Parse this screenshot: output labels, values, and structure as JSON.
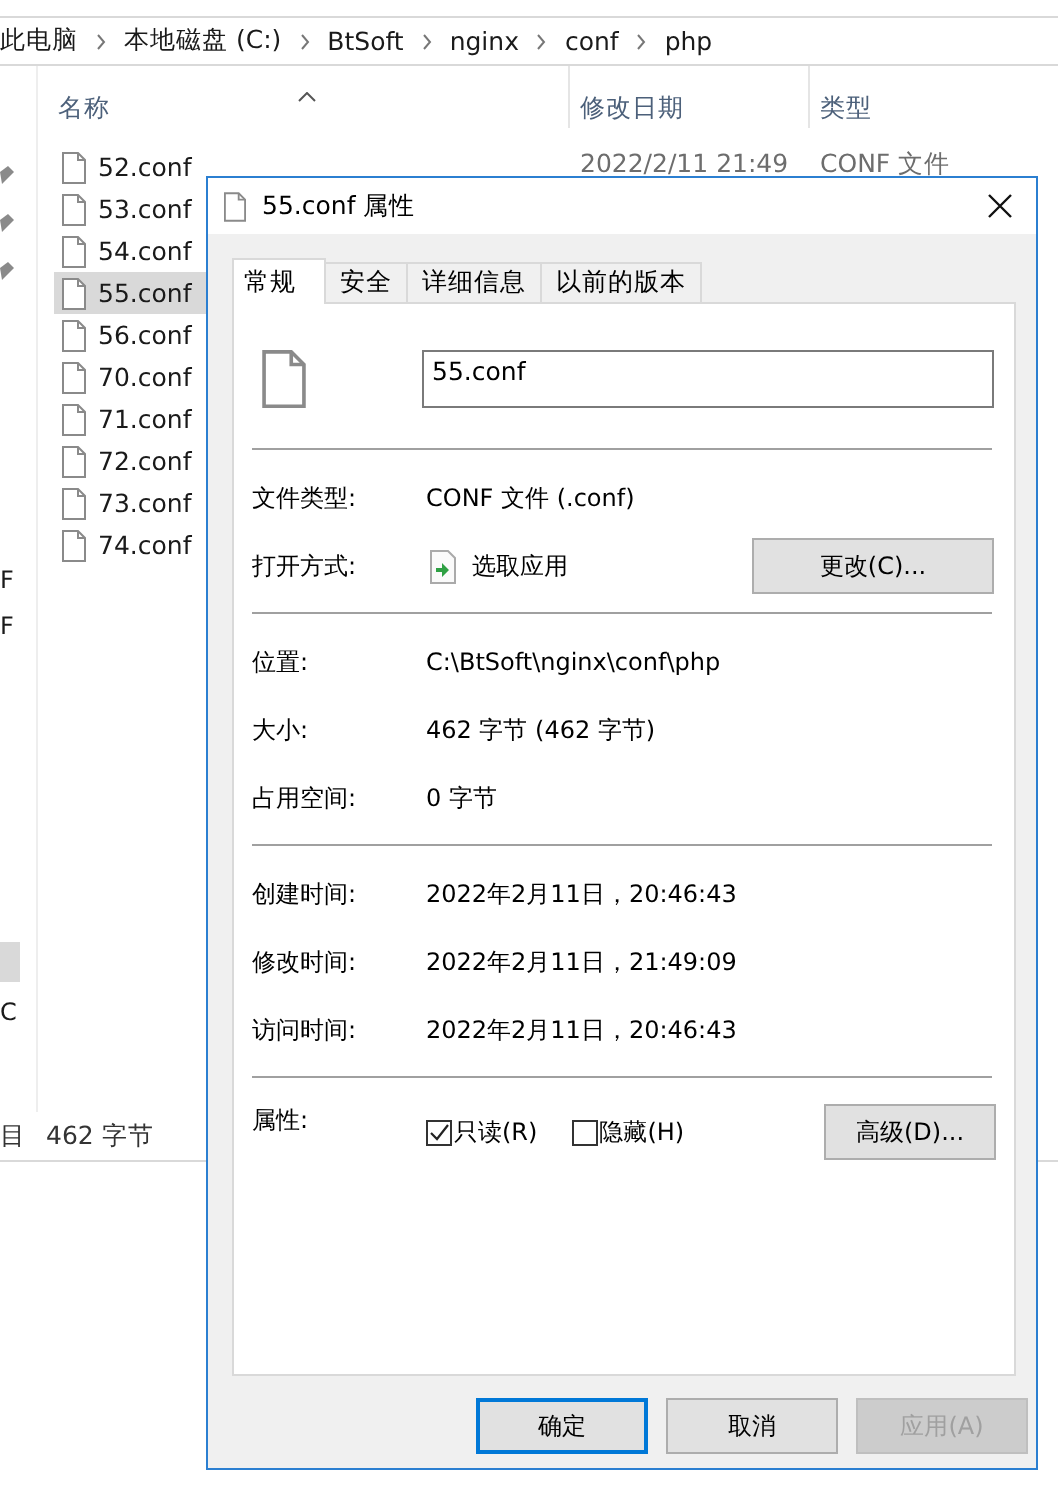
{
  "explorer": {
    "breadcrumb": [
      "此电脑",
      "本地磁盘 (C:)",
      "BtSoft",
      "nginx",
      "conf",
      "php"
    ],
    "columns": [
      "名称",
      "修改日期",
      "类型"
    ],
    "files": [
      {
        "name": "52.conf",
        "modified": "2022/2/11 21:49",
        "type": "CONF 文件",
        "selected": false
      },
      {
        "name": "53.conf",
        "selected": false
      },
      {
        "name": "54.conf",
        "selected": false
      },
      {
        "name": "55.conf",
        "selected": true
      },
      {
        "name": "56.conf",
        "selected": false
      },
      {
        "name": "70.conf",
        "selected": false
      },
      {
        "name": "71.conf",
        "selected": false
      },
      {
        "name": "72.conf",
        "selected": false
      },
      {
        "name": "73.conf",
        "selected": false
      },
      {
        "name": "74.conf",
        "selected": false
      }
    ],
    "nav_fragments": [
      "F",
      "F",
      "C"
    ],
    "status_bar": {
      "items": "目",
      "size": "462 字节"
    }
  },
  "dialog": {
    "title": "55.conf 属性",
    "tabs": [
      {
        "label": "常规",
        "selected": true
      },
      {
        "label": "安全",
        "selected": false
      },
      {
        "label": "详细信息",
        "selected": false
      },
      {
        "label": "以前的版本",
        "selected": false
      }
    ],
    "file_name": "55.conf",
    "groups": [
      [
        {
          "label": "文件类型:",
          "value": "CONF 文件 (.conf)"
        },
        {
          "label": "打开方式:",
          "value": "选取应用",
          "button": "更改(C)..."
        }
      ],
      [
        {
          "label": "位置:",
          "value": "C:\\BtSoft\\nginx\\conf\\php"
        },
        {
          "label": "大小:",
          "value": "462 字节 (462 字节)"
        },
        {
          "label": "占用空间:",
          "value": "0 字节"
        }
      ],
      [
        {
          "label": "创建时间:",
          "value": "2022年2月11日，20:46:43"
        },
        {
          "label": "修改时间:",
          "value": "2022年2月11日，21:49:09"
        },
        {
          "label": "访问时间:",
          "value": "2022年2月11日，20:46:43"
        }
      ]
    ],
    "attributes": {
      "label": "属性:",
      "checkboxes": [
        {
          "label": "只读(R)",
          "checked": true
        },
        {
          "label": "隐藏(H)",
          "checked": false
        }
      ],
      "button": "高级(D)..."
    },
    "buttons": [
      {
        "label": "确定",
        "kind": "default",
        "disabled": false
      },
      {
        "label": "取消",
        "kind": "normal",
        "disabled": false
      },
      {
        "label": "应用(A)",
        "kind": "normal",
        "disabled": true
      }
    ]
  }
}
